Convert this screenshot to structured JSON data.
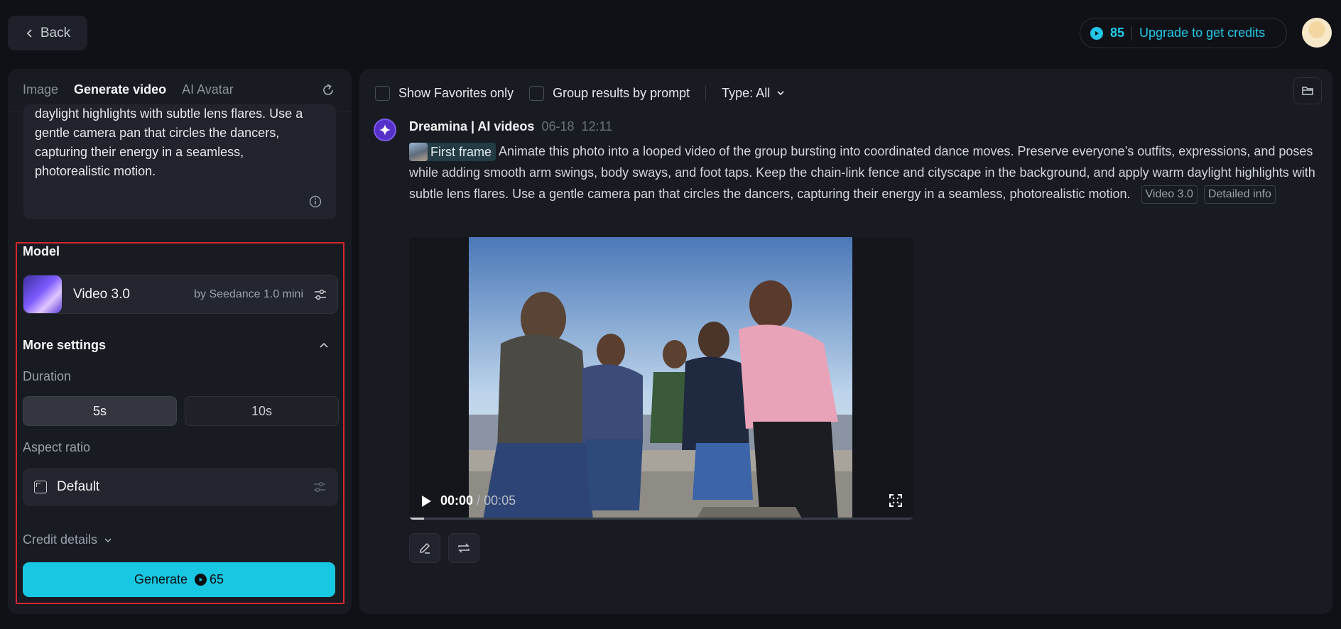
{
  "header": {
    "back_label": "Back",
    "credits": "85",
    "upgrade_label": "Upgrade to get credits"
  },
  "left": {
    "tabs": [
      {
        "label": "Image",
        "active": false
      },
      {
        "label": "Generate video",
        "active": true
      },
      {
        "label": "AI Avatar",
        "active": false
      }
    ],
    "prompt_text": "daylight highlights with subtle lens flares. Use a gentle camera pan that circles the dancers, capturing their energy in a seamless, photorealistic motion.",
    "model": {
      "section_title": "Model",
      "name": "Video 3.0",
      "by": "by Seedance 1.0 mini"
    },
    "more_settings": {
      "title": "More settings",
      "duration_label": "Duration",
      "durations": [
        "5s",
        "10s"
      ],
      "selected_duration": "5s",
      "aspect_label": "Aspect ratio",
      "aspect_value": "Default"
    },
    "credit_details_label": "Credit details",
    "generate": {
      "label": "Generate",
      "cost": "65"
    }
  },
  "right": {
    "filters": {
      "favorites_label": "Show Favorites only",
      "group_label": "Group results by prompt",
      "type_label": "Type: All"
    },
    "post": {
      "author": "Dreamina | AI videos",
      "date": "06-18",
      "time": "12:11",
      "first_frame_label": "First frame",
      "text": "Animate this photo into a looped video of the group bursting into coordinated dance moves. Preserve everyone’s outfits, expressions, and poses while adding smooth arm swings, body sways, and foot taps. Keep the chain-link fence and cityscape in the background, and apply warm daylight highlights with subtle lens flares. Use a gentle camera pan that circles the dancers, capturing their energy in a seamless, photorealistic motion.",
      "model_tag": "Video 3.0",
      "detailed_info_label": "Detailed info"
    },
    "video": {
      "current_time": "00:00",
      "total_time": "/ 00:05",
      "progress": 0.03
    }
  },
  "colors": {
    "accent": "#18c8e2",
    "highlight_frame": "#d7262f",
    "background": "#0f1117",
    "panel": "#181b22"
  },
  "icons": [
    "chevron-left-icon",
    "coin-icon",
    "refresh-icon",
    "info-icon",
    "sliders-icon",
    "chevron-up-icon",
    "aspect-ratio-icon",
    "chevron-down-icon",
    "folder-icon",
    "dreamina-logo-icon",
    "play-icon",
    "fullscreen-icon",
    "edit-icon",
    "regenerate-icon"
  ]
}
